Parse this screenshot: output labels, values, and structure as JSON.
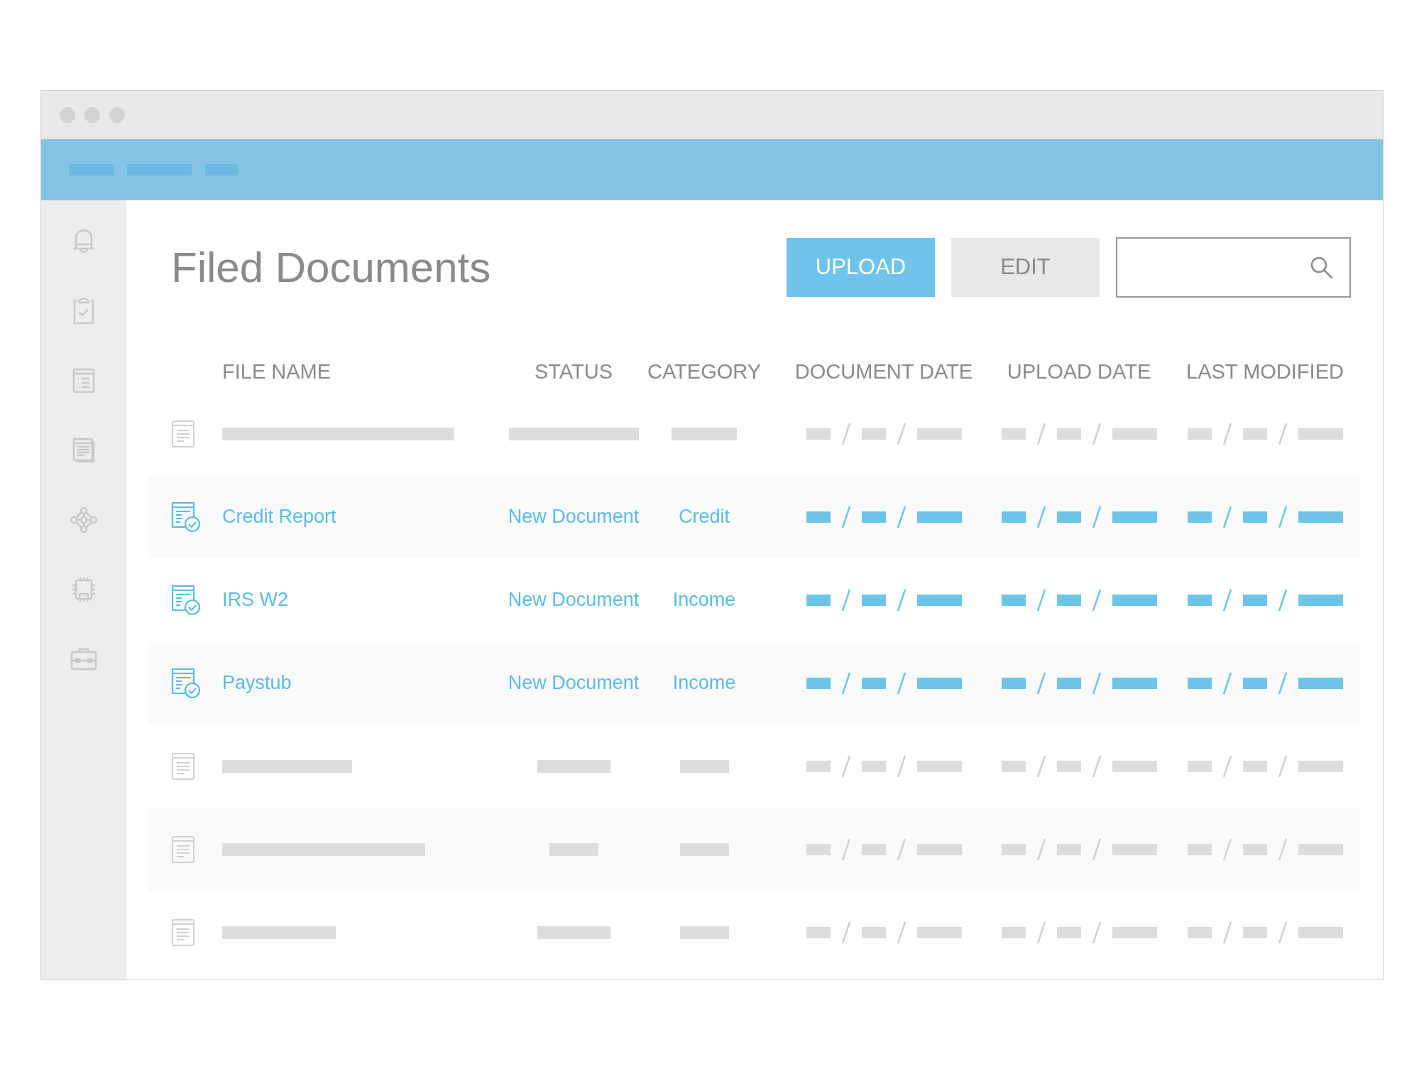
{
  "page": {
    "title": "Filed Documents"
  },
  "toolbar": {
    "buttons": [
      {
        "label": "UPLOAD",
        "kind": "primary"
      },
      {
        "label": "EDIT",
        "kind": "secondary"
      }
    ]
  },
  "table": {
    "columns": [
      "FILE NAME",
      "STATUS",
      "CATEGORY",
      "DOCUMENT DATE",
      "UPLOAD DATE",
      "LAST MODIFIED"
    ],
    "rows": [
      {
        "kind": "placeholder"
      },
      {
        "kind": "document",
        "file_name": "Credit Report",
        "status": "New Document",
        "category": "Credit"
      },
      {
        "kind": "document",
        "file_name": "IRS W2",
        "status": "New Document",
        "category": "Income"
      },
      {
        "kind": "document",
        "file_name": "Paystub",
        "status": "New Document",
        "category": "Income"
      },
      {
        "kind": "placeholder"
      },
      {
        "kind": "placeholder"
      },
      {
        "kind": "placeholder"
      }
    ]
  }
}
